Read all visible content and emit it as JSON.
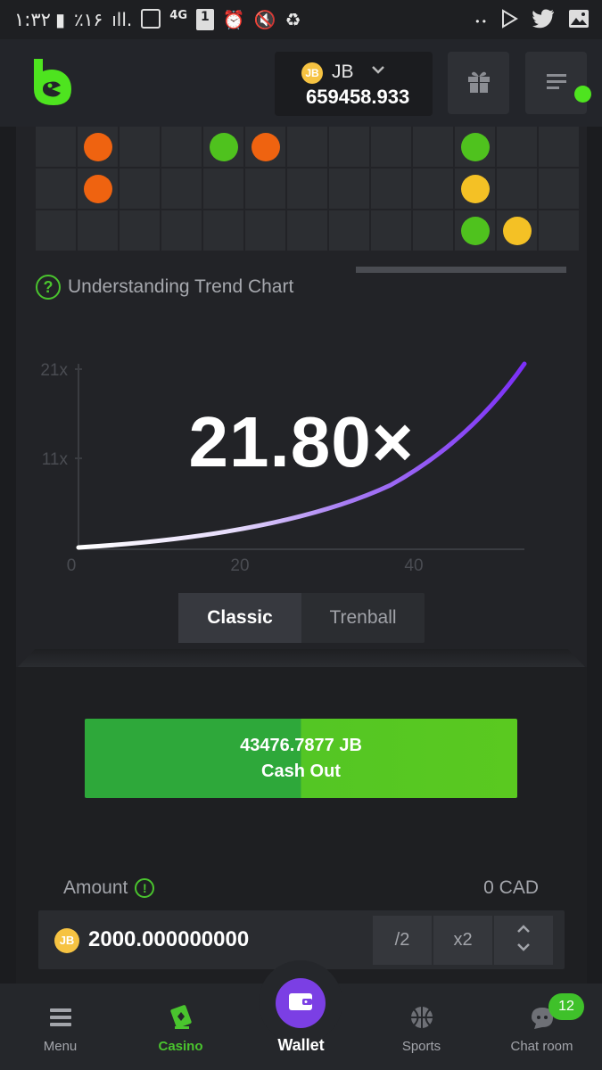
{
  "statusbar": {
    "time": "۱:۳۲",
    "battery": "٪۱۶",
    "network": "4G",
    "sim": "1",
    "dots": "• •"
  },
  "header": {
    "currency": "JB",
    "coin_label": "JB",
    "balance": "659458.933",
    "brand_color": "#4ee41f"
  },
  "trend_grid": {
    "rows": [
      [
        "",
        "orange",
        "",
        "",
        "green",
        "orange",
        "",
        "",
        "",
        "",
        "green",
        "",
        ""
      ],
      [
        "",
        "orange",
        "",
        "",
        "",
        "",
        "",
        "",
        "",
        "",
        "yellow",
        "",
        ""
      ],
      [
        "",
        "",
        "",
        "",
        "",
        "",
        "",
        "",
        "",
        "",
        "green",
        "yellow",
        ""
      ]
    ],
    "colors": {
      "orange": "#ef6310",
      "green": "#4fc21e",
      "yellow": "#f4c125"
    }
  },
  "help": {
    "label": "Understanding Trend Chart"
  },
  "chart_data": {
    "type": "line",
    "y_ticks": [
      "21x",
      "11x"
    ],
    "x_ticks": [
      "0",
      "20",
      "40"
    ],
    "current_multiplier": "21.80×",
    "curve_color": "#7b2ff7"
  },
  "modes": {
    "classic": "Classic",
    "trenball": "Trenball"
  },
  "cashout": {
    "amount": "43476.7877 JB",
    "label": "Cash Out"
  },
  "amount": {
    "label": "Amount",
    "fiat": "0 CAD",
    "coin_label": "JB",
    "value": "2000.000000000",
    "half": "/2",
    "double": "x2"
  },
  "nav": {
    "menu": "Menu",
    "casino": "Casino",
    "wallet": "Wallet",
    "sports": "Sports",
    "chat": "Chat room",
    "chat_badge": "12"
  }
}
